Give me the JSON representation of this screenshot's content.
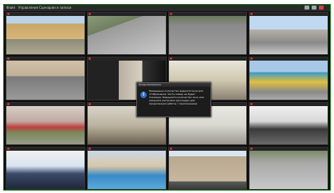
{
  "menu": [
    {
      "label": "Файл"
    },
    {
      "label": "Управление"
    },
    {
      "label": "Сценарии и записи"
    }
  ],
  "cells": [
    {
      "id": "cam-01",
      "scene": "courtyard-buildings"
    },
    {
      "id": "cam-02",
      "scene": "parking-lot-cars"
    },
    {
      "id": "cam-03",
      "scene": "parking-lot-top"
    },
    {
      "id": "cam-04",
      "scene": "city-street-cars"
    },
    {
      "id": "cam-05",
      "scene": "town-square-cars"
    },
    {
      "id": "cam-06",
      "scene": "office-doorway"
    },
    {
      "id": "cam-07",
      "scene": "office-ceiling-lights"
    },
    {
      "id": "cam-08",
      "scene": "colorful-building"
    },
    {
      "id": "cam-09",
      "scene": "playground-yard"
    },
    {
      "id": "cam-10",
      "scene": "office-desk"
    },
    {
      "id": "cam-11",
      "scene": "office-room"
    },
    {
      "id": "cam-12",
      "scene": "lounge-people"
    },
    {
      "id": "cam-13",
      "scene": "control-room"
    },
    {
      "id": "cam-14",
      "scene": "resort-pool"
    },
    {
      "id": "cam-15",
      "scene": "building-facade"
    },
    {
      "id": "cam-16",
      "scene": "parking-lot-wide"
    }
  ],
  "dialog": {
    "title": "Предупреждение",
    "info_icon": "i",
    "text": "Превышено количество видеопотоков для отображения. Часть камер не будет показана. Уменьшите количество окон или измените настройки раскладки для продолжения работы с приложением."
  },
  "colors": {
    "frame_border": "#1a7a1a",
    "background": "#0c0c0c",
    "dialog_bg": "#1c1c1c"
  }
}
